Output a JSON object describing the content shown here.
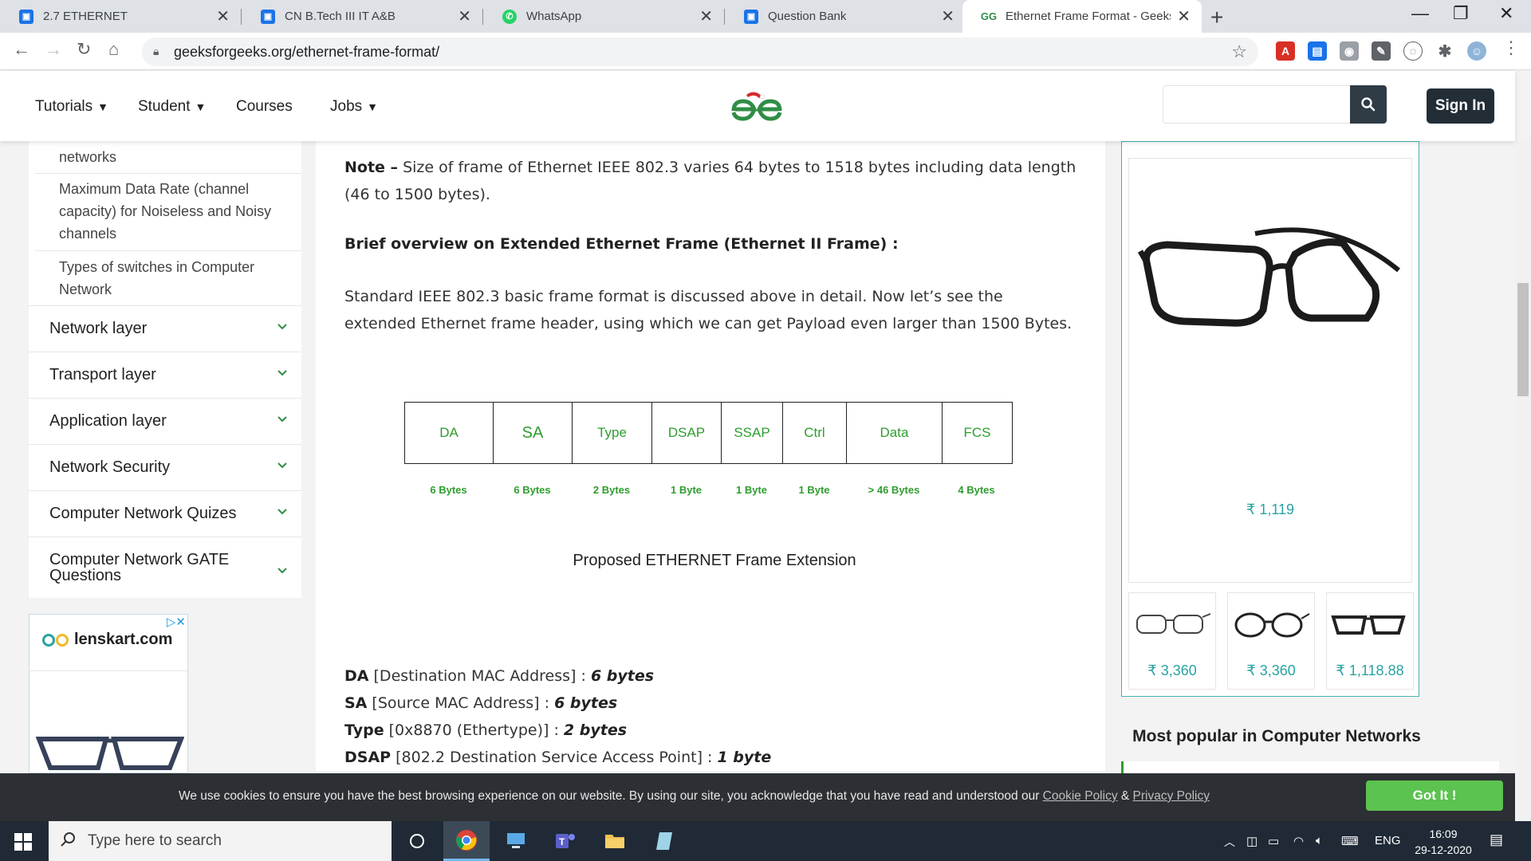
{
  "browser": {
    "tabs": [
      {
        "title": "2.7 ETHERNET",
        "icon": "google-classroom-icon",
        "color": "#1a73e8"
      },
      {
        "title": "CN B.Tech III IT A&B",
        "icon": "google-classroom-icon",
        "color": "#1a73e8"
      },
      {
        "title": "WhatsApp",
        "icon": "whatsapp-icon",
        "color": "#25d366"
      },
      {
        "title": "Question Bank",
        "icon": "google-classroom-icon",
        "color": "#1a73e8"
      },
      {
        "title": "Ethernet Frame Format - Geeksfc",
        "icon": "gfg-icon",
        "color": "#2f8d46"
      }
    ],
    "url": "geeksforgeeks.org/ethernet-frame-format/"
  },
  "header": {
    "menu": [
      {
        "label": "Tutorials",
        "has_dropdown": true
      },
      {
        "label": "Student",
        "has_dropdown": true
      },
      {
        "label": "Courses",
        "has_dropdown": false
      },
      {
        "label": "Jobs",
        "has_dropdown": true
      }
    ],
    "search_placeholder": "",
    "signin_label": "Sign In"
  },
  "sidebar": {
    "sub_links": [
      {
        "label": "networks"
      },
      {
        "label": "Maximum Data Rate (channel capacity) for Noiseless and Noisy channels"
      },
      {
        "label": "Types of switches in Computer Network"
      }
    ],
    "categories": [
      {
        "label": "Network layer"
      },
      {
        "label": "Transport layer"
      },
      {
        "label": "Application layer"
      },
      {
        "label": "Network Security"
      },
      {
        "label": "Computer Network Quizes"
      },
      {
        "label": "Computer Network GATE Questions"
      }
    ],
    "ad": {
      "brand": "lenskart.com"
    }
  },
  "article": {
    "note_label": "Note –",
    "note_text": " Size of frame of Ethernet IEEE 802.3 varies 64 bytes to 1518 bytes including data length (46 to 1500 bytes).",
    "heading": "Brief overview on Extended Ethernet Frame (Ethernet II Frame) :",
    "intro": "Standard IEEE 802.3 basic frame format is discussed above in detail. Now let’s see the extended Ethernet frame header, using which we can get Payload even larger than 1500 Bytes.",
    "frame_fields": [
      {
        "name": "DA",
        "size": "6 Bytes"
      },
      {
        "name": "SA",
        "size": "6 Bytes"
      },
      {
        "name": "Type",
        "size": "2 Bytes"
      },
      {
        "name": "DSAP",
        "size": "1 Byte"
      },
      {
        "name": "SSAP",
        "size": "1 Byte"
      },
      {
        "name": "Ctrl",
        "size": "1 Byte"
      },
      {
        "name": "Data",
        "size": "> 46 Bytes"
      },
      {
        "name": "FCS",
        "size": "4 Bytes"
      }
    ],
    "figure_caption": "Proposed ETHERNET Frame Extension",
    "field_descriptions": [
      {
        "name": "DA",
        "desc": " [Destination MAC Address] : ",
        "value": "6 bytes"
      },
      {
        "name": "SA",
        "desc": " [Source MAC Address] : ",
        "value": "6 bytes"
      },
      {
        "name": "Type",
        "desc": " [0x8870 (Ethertype)] : ",
        "value": "2 bytes"
      },
      {
        "name": "DSAP",
        "desc": " [802.2 Destination Service Access Point] : ",
        "value": "1 byte"
      }
    ]
  },
  "right_ad": {
    "main_price": "₹ 1,119",
    "thumbs": [
      {
        "price": "₹ 3,360"
      },
      {
        "price": "₹ 3,360"
      },
      {
        "price": "₹ 1,118.88"
      }
    ],
    "accent": "#29a3a3"
  },
  "popular_heading": "Most popular in Computer Networks",
  "cookie": {
    "message": "We use cookies to ensure you have the best browsing experience on our website. By using our site, you acknowledge that you have read and understood our ",
    "cookie_policy": "Cookie Policy",
    "amp": " & ",
    "privacy_policy": "Privacy Policy",
    "button": "Got It !"
  },
  "taskbar": {
    "search_placeholder": "Type here to search",
    "language": "ENG",
    "time": "16:09",
    "date": "29-12-2020"
  },
  "colors": {
    "gfg_green": "#2f8d46",
    "frame_green": "#2e9d2e",
    "got_it_green": "#5cc250"
  }
}
